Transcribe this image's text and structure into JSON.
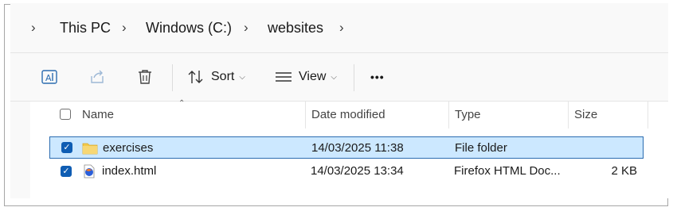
{
  "breadcrumb": {
    "items": [
      "This PC",
      "Windows (C:)",
      "websites"
    ]
  },
  "toolbar": {
    "sort_label": "Sort",
    "view_label": "View",
    "more_label": "•••",
    "icons": [
      "rename-icon",
      "share-icon",
      "delete-icon",
      "sort-icon",
      "view-icon",
      "more-icon"
    ]
  },
  "columns": {
    "name": "Name",
    "date": "Date modified",
    "type": "Type",
    "size": "Size"
  },
  "files": [
    {
      "name": "exercises",
      "date": "14/03/2025 11:38",
      "type": "File folder",
      "size": "",
      "selected": true,
      "icon": "folder-icon"
    },
    {
      "name": "index.html",
      "date": "14/03/2025 13:34",
      "type": "Firefox HTML Doc...",
      "size": "2 KB",
      "selected": true,
      "icon": "firefox-html-icon"
    }
  ],
  "colors": {
    "accent": "#0f5db3",
    "selection": "#cce8ff",
    "folder": "#f2c94c"
  }
}
